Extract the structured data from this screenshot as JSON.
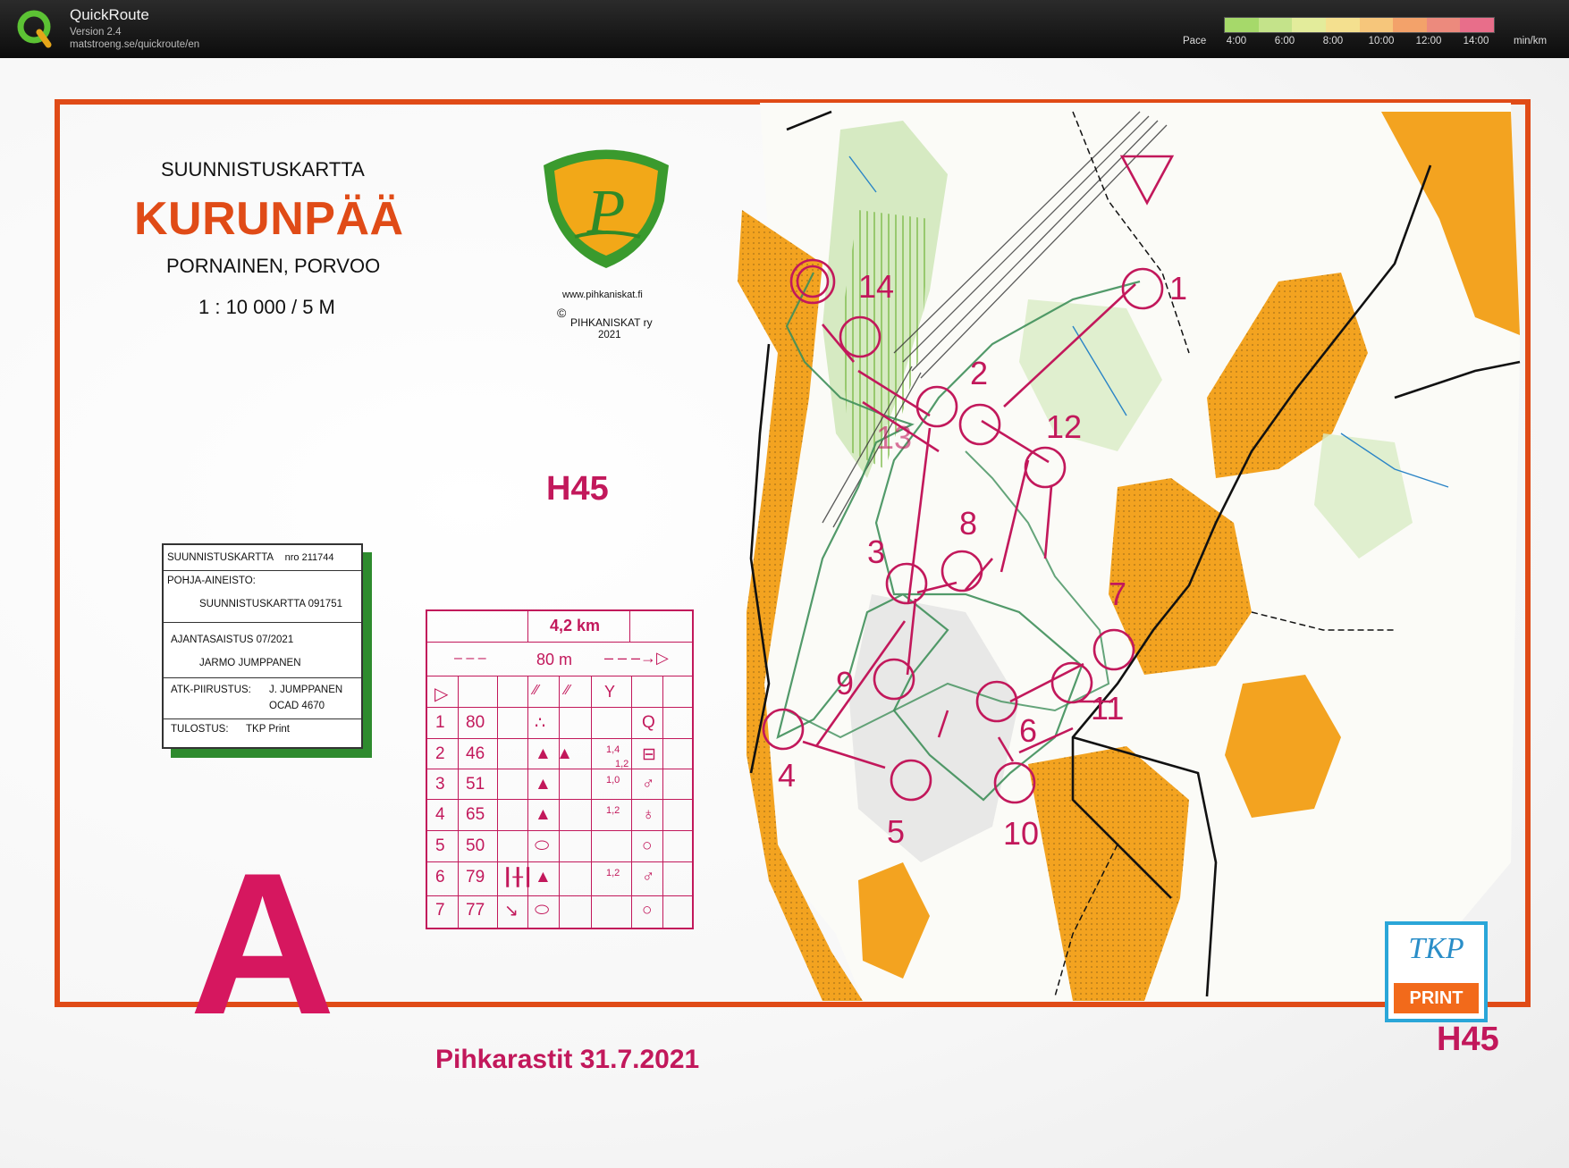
{
  "app": {
    "title": "QuickRoute",
    "version": "Version 2.4",
    "url": "matstroeng.se/quickroute/en"
  },
  "pace_legend": {
    "label": "Pace",
    "ticks": [
      "4:00",
      "6:00",
      "8:00",
      "10:00",
      "12:00",
      "14:00"
    ],
    "unit": "min/km",
    "colors": [
      "#a6d96a",
      "#c4e38a",
      "#e3ec9b",
      "#f4e08f",
      "#f6c67b",
      "#f3a26a",
      "#ec8a7d",
      "#e86e8a"
    ]
  },
  "map": {
    "header": "SUUNNISTUSKARTTA",
    "name": "KURUNPÄÄ",
    "location": "PORNAINEN, PORVOO",
    "scale": "1 : 10 000 / 5 M",
    "club_url": "www.pihkaniskat.fi",
    "copyright_symbol": "©",
    "club_name": "PIHKANISKAT ry",
    "year": "2021",
    "class_label": "H45",
    "class_label_bottom": "H45",
    "course_letter": "A",
    "event": "Pihkarastit 31.7.2021",
    "print_logo_top": "TKP",
    "print_logo_bottom": "PRINT"
  },
  "infobox": {
    "title": "SUUNNISTUSKARTTA",
    "number": "nro 211744",
    "base_label": "POHJA-AINEISTO:",
    "base_value": "SUUNNISTUSKARTTA 091751",
    "update_label": "AJANTASAISTUS 07/2021",
    "update_person": "JARMO JUMPPANEN",
    "drawing_label": "ATK-PIIRUSTUS:",
    "drawing_person": "J. JUMPPANEN",
    "drawing_software": "OCAD 4670",
    "print_label": "TULOSTUS:",
    "print_value": "TKP Print"
  },
  "description_sheet": {
    "length": "4,2 km",
    "climb": "80 m",
    "rows": [
      {
        "num": "1",
        "code": "80",
        "size": ""
      },
      {
        "num": "2",
        "code": "46",
        "size": "1,4"
      },
      {
        "num": "3",
        "code": "51",
        "size": "1,0"
      },
      {
        "num": "4",
        "code": "65",
        "size": "1,2"
      },
      {
        "num": "5",
        "code": "50",
        "size": ""
      },
      {
        "num": "6",
        "code": "79",
        "size": "1,2"
      },
      {
        "num": "7",
        "code": "77",
        "size": ""
      }
    ],
    "row2_size2": "1,2"
  },
  "controls": [
    "1",
    "2",
    "3",
    "4",
    "5",
    "6",
    "7",
    "8",
    "9",
    "10",
    "11",
    "12",
    "13",
    "14"
  ],
  "colors": {
    "course": "#c2185b",
    "route": "#3f8f5a",
    "map_orange": "#f3a320",
    "map_border": "#e04b17"
  }
}
